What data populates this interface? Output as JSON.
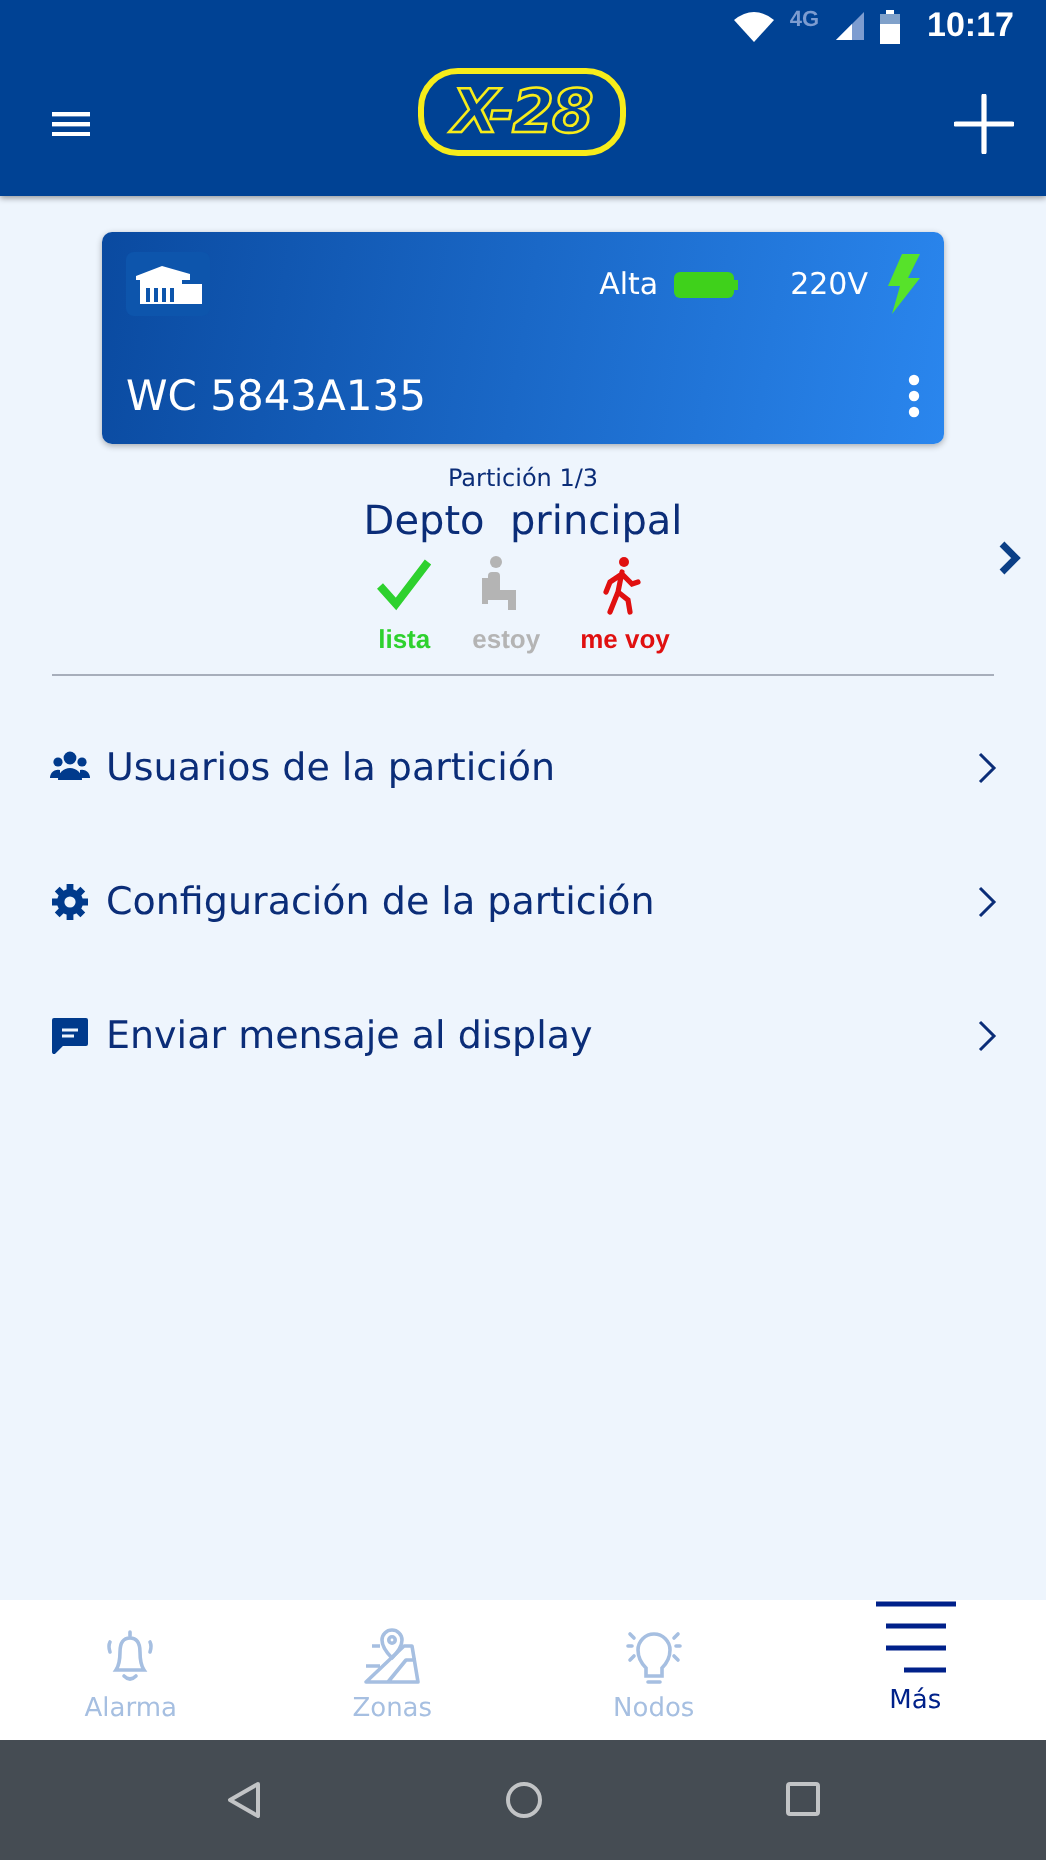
{
  "status_bar": {
    "network": "4G",
    "time": "10:17"
  },
  "header": {
    "logo": "X-28"
  },
  "device": {
    "battery_label": "Alta",
    "power": "220V",
    "name": "WC 5843A135"
  },
  "partition": {
    "counter": "Partición 1/3",
    "name": "Depto  principal",
    "modes": [
      {
        "kind": "check",
        "label": "lista",
        "color": "#2ed12e"
      },
      {
        "kind": "seated",
        "label": "estoy",
        "color": "#b4b4b4"
      },
      {
        "kind": "walking",
        "label": "me voy",
        "color": "#e01010"
      }
    ]
  },
  "menu": [
    {
      "kind": "users",
      "label": "Usuarios de la partición"
    },
    {
      "kind": "gear",
      "label": "Configuración de la partición"
    },
    {
      "kind": "message",
      "label": "Enviar mensaje al display"
    }
  ],
  "bottom_nav": [
    {
      "kind": "bell",
      "label": "Alarma",
      "selected": false
    },
    {
      "kind": "map",
      "label": "Zonas",
      "selected": false
    },
    {
      "kind": "bulb",
      "label": "Nodos",
      "selected": false
    },
    {
      "kind": "menu",
      "label": "Más",
      "selected": true
    }
  ]
}
